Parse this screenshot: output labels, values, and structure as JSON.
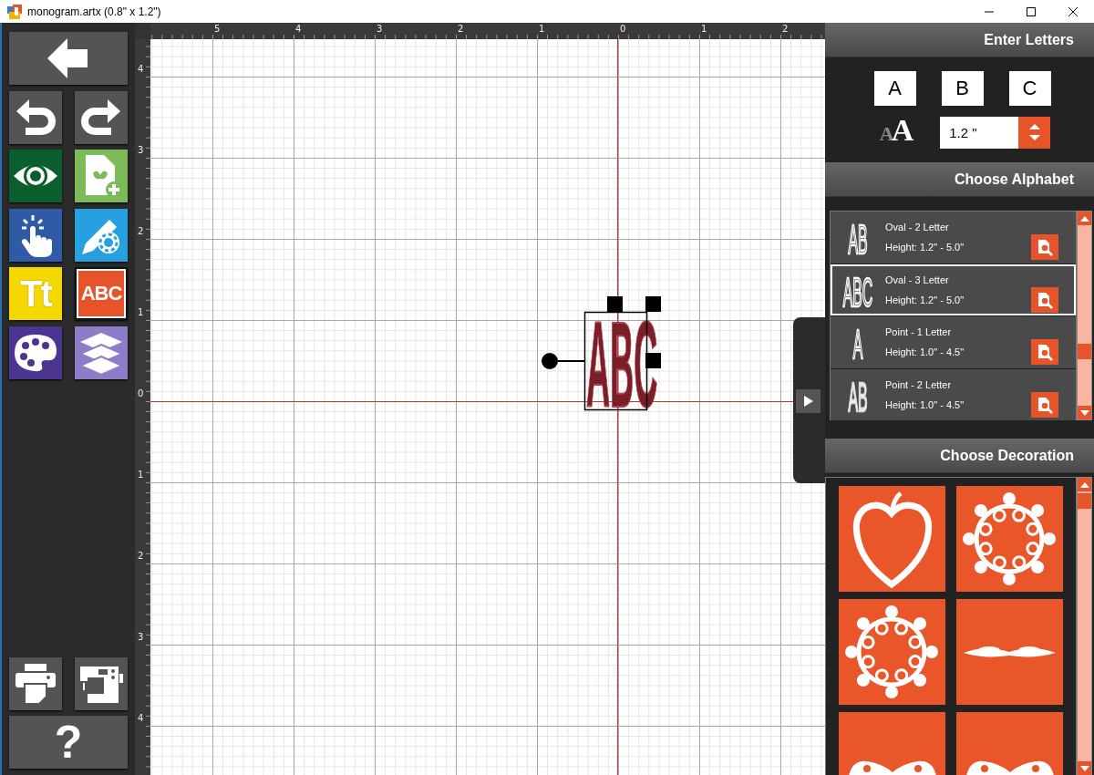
{
  "window": {
    "title": "monogram.artx (0.8\" x 1.2\")"
  },
  "tools": [
    {
      "kind": "back",
      "selected": false
    },
    {
      "kind": "undo",
      "selected": false
    },
    {
      "kind": "redo",
      "selected": false
    },
    {
      "kind": "preview",
      "selected": false
    },
    {
      "kind": "add-design",
      "selected": false
    },
    {
      "kind": "select",
      "selected": false
    },
    {
      "kind": "edit",
      "selected": false
    },
    {
      "kind": "text",
      "glyph": "Tt",
      "selected": false
    },
    {
      "kind": "monogram",
      "glyph": "ABC",
      "selected": true
    },
    {
      "kind": "palette",
      "selected": false
    },
    {
      "kind": "layers",
      "selected": false
    }
  ],
  "bottom_tools": [
    {
      "kind": "print"
    },
    {
      "kind": "sew"
    },
    {
      "kind": "help",
      "glyph": "?"
    }
  ],
  "rulers": {
    "horizontal": [
      "5",
      "4",
      "3",
      "2",
      "1",
      "0",
      "1",
      "2"
    ],
    "vertical": [
      "4",
      "3",
      "2",
      "1",
      "0",
      "1",
      "2",
      "3",
      "4"
    ]
  },
  "design": {
    "letters": "ABC"
  },
  "enter_letters": {
    "title": "Enter Letters",
    "letters": [
      "A",
      "B",
      "C"
    ],
    "size_icon": "AA",
    "height": "1.2 \""
  },
  "choose_alphabet": {
    "title": "Choose Alphabet",
    "items": [
      {
        "preview": "AB",
        "kind": "outline",
        "name": "Oval - 2 Letter",
        "height": "Height: 1.2\" - 5.0\"",
        "selected": false
      },
      {
        "preview": "ABC",
        "kind": "outline",
        "name": "Oval - 3 Letter",
        "height": "Height: 1.2\" - 5.0\"",
        "selected": true
      },
      {
        "preview": "A",
        "kind": "outline",
        "name": "Point - 1 Letter",
        "height": "Height: 1.0\" - 4.5\"",
        "selected": false
      },
      {
        "preview": "AB",
        "kind": "solid",
        "name": "Point - 2 Letter",
        "height": "Height: 1.0\" - 4.5\"",
        "selected": false
      }
    ]
  },
  "choose_decoration": {
    "title": "Choose Decoration",
    "items": [
      {
        "kind": "heart"
      },
      {
        "kind": "wreath"
      },
      {
        "kind": "wreath"
      },
      {
        "kind": "flourish"
      },
      {
        "kind": "flourish-low"
      },
      {
        "kind": "flourish-low"
      }
    ]
  }
}
